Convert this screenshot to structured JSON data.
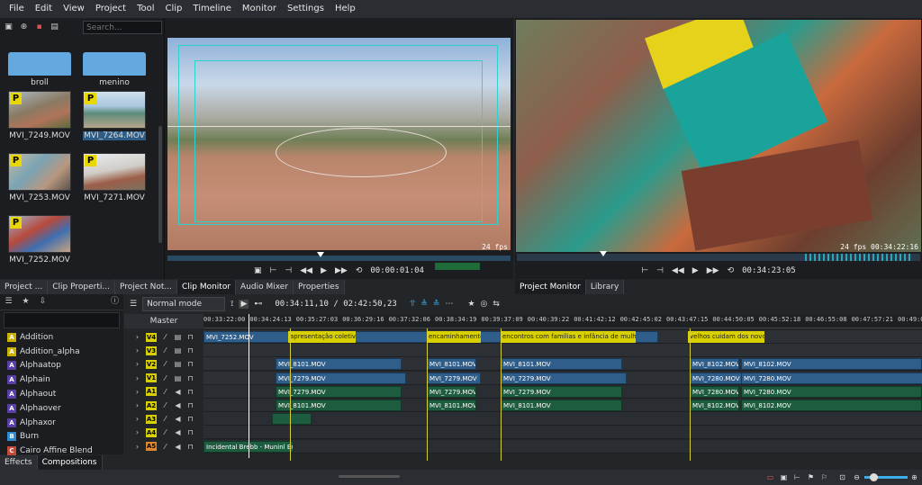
{
  "menu": [
    "File",
    "Edit",
    "View",
    "Project",
    "Tool",
    "Clip",
    "Timeline",
    "Monitor",
    "Settings",
    "Help"
  ],
  "bin": {
    "search_placeholder": "Search...",
    "folders": [
      "broll",
      "menino"
    ],
    "clips": [
      "MVI_7249.MOV",
      "MVI_7264.MOV",
      "MVI_7253.MOV",
      "MVI_7271.MOV",
      "MVI_7252.MOV"
    ],
    "proxy_badge": "P"
  },
  "clip_monitor": {
    "timecode": "00:00:01:04",
    "fps": "24 fps"
  },
  "project_monitor": {
    "timecode": "00:34:23:05",
    "fps_overlay": "24 fps  00:34:22:16"
  },
  "upper_tabs": [
    "Project ...",
    "Clip Properti...",
    "Project Not...",
    "Clip Monitor",
    "Audio Mixer",
    "Properties"
  ],
  "monitor_tabs": [
    "Project Monitor",
    "Library"
  ],
  "effects": {
    "items": [
      {
        "label": "Addition",
        "color": "#c9b200",
        "icon": "A"
      },
      {
        "label": "Addition_alpha",
        "color": "#c9b200",
        "icon": "A"
      },
      {
        "label": "Alphaatop",
        "color": "#5a3ea8",
        "icon": "A"
      },
      {
        "label": "Alphain",
        "color": "#5a3ea8",
        "icon": "A"
      },
      {
        "label": "Alphaout",
        "color": "#5a3ea8",
        "icon": "A"
      },
      {
        "label": "Alphaover",
        "color": "#5a3ea8",
        "icon": "A"
      },
      {
        "label": "Alphaxor",
        "color": "#5a3ea8",
        "icon": "A"
      },
      {
        "label": "Burn",
        "color": "#2d8ad0",
        "icon": "B"
      },
      {
        "label": "Cairo Affine Blend",
        "color": "#c34a3b",
        "icon": "C"
      }
    ]
  },
  "bottom_tabs": [
    "Effects",
    "Compositions"
  ],
  "timeline": {
    "mode": "Normal mode",
    "timecode": "00:34:11,10 / 02:42:50,23",
    "master_label": "Master",
    "ruler": [
      "00:33:22:00",
      "00:34:24:13",
      "00:35:27:03",
      "00:36:29:16",
      "00:37:32:06",
      "00:38:34:19",
      "00:39:37:09",
      "00:40:39:22",
      "00:41:42:12",
      "00:42:45:02",
      "00:43:47:15",
      "00:44:50:05",
      "00:45:52:18",
      "00:46:55:08",
      "00:47:57:21",
      "00:49:00:1"
    ],
    "current_marker": "00:34:24:13",
    "tracks": [
      {
        "name": "V4",
        "type": "video",
        "color": "#d8d000"
      },
      {
        "name": "V3",
        "type": "video",
        "color": "#d8d000"
      },
      {
        "name": "V2",
        "type": "video",
        "color": "#d8d000"
      },
      {
        "name": "V1",
        "type": "video",
        "color": "#d8d000"
      },
      {
        "name": "A1",
        "type": "audio",
        "color": "#d8d000"
      },
      {
        "name": "A2",
        "type": "audio",
        "color": "#d8d000"
      },
      {
        "name": "A3",
        "type": "audio",
        "color": "#d8d000"
      },
      {
        "name": "A4",
        "type": "audio",
        "color": "#d8d000"
      },
      {
        "name": "A5",
        "type": "audio",
        "color": "#e0892c"
      }
    ],
    "clips": {
      "v4_base": "MVI_7252.MOV",
      "titles": [
        "apresentação coletivo",
        "encaminhamento",
        "encontros com famílias e infância de mulheres",
        "velhos cuidam dos novos"
      ],
      "v2": [
        "MVI_8101.MOV",
        "MVI_8101.MOV",
        "MVI_8101.MOV",
        "MVI_8102.MOV",
        "MVI_8102.MOV"
      ],
      "v1": [
        "MVI_7279.MOV",
        "MVI_7279.MOV",
        "MVI_7279.MOV",
        "MVI_7280.MOV",
        "MVI_7280.MOV"
      ],
      "a1": [
        "MVI_7279.MOV",
        "MVI_7279.MOV",
        "MVI_7279.MOV",
        "MVI_7280.MOV",
        "MVI_7280.MOV"
      ],
      "a2": [
        "MVI_8101.MOV",
        "MVI_8101.MOV",
        "MVI_8101.MOV",
        "MVI_8102.MOV",
        "MVI_8102.MOV"
      ],
      "a5": "Incidental Brebb - Muninl Entrelte"
    }
  },
  "colors": {
    "accent": "#3daee9",
    "video_clip": "#2f5e8a",
    "audio_clip": "#1d5c3e",
    "guide": "#d7cd3a"
  }
}
